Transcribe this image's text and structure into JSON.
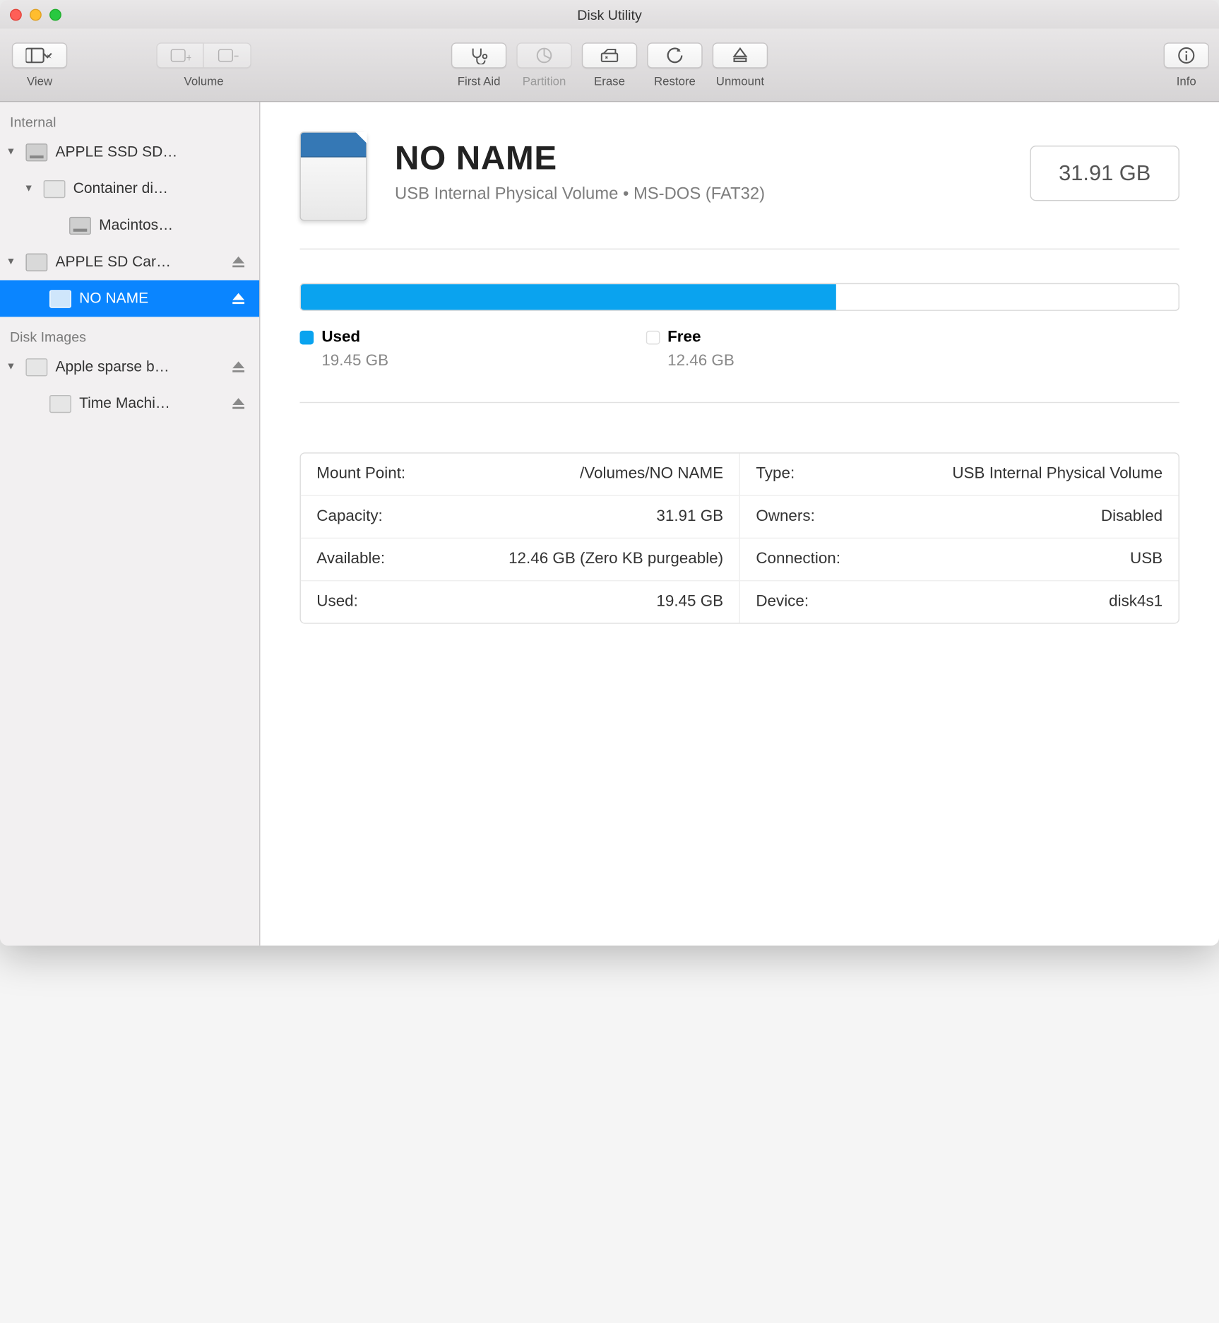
{
  "window": {
    "title": "Disk Utility"
  },
  "toolbar": {
    "view": "View",
    "volume": "Volume",
    "first_aid": "First Aid",
    "partition": "Partition",
    "erase": "Erase",
    "restore": "Restore",
    "unmount": "Unmount",
    "info": "Info"
  },
  "sidebar": {
    "group_internal": "Internal",
    "group_disk_images": "Disk Images",
    "items": [
      {
        "label": "APPLE SSD SD…"
      },
      {
        "label": "Container di…"
      },
      {
        "label": "Macintos…"
      },
      {
        "label": "APPLE SD Car…"
      },
      {
        "label": "NO NAME"
      },
      {
        "label": "Apple sparse b…"
      },
      {
        "label": "Time Machi…"
      }
    ]
  },
  "volume": {
    "name": "NO NAME",
    "subtitle": "USB Internal Physical Volume • MS-DOS (FAT32)",
    "size": "31.91 GB",
    "used_label": "Used",
    "used_value": "19.45 GB",
    "free_label": "Free",
    "free_value": "12.46 GB",
    "used_percent": 61
  },
  "details": {
    "left": [
      {
        "k": "Mount Point:",
        "v": "/Volumes/NO NAME"
      },
      {
        "k": "Capacity:",
        "v": "31.91 GB"
      },
      {
        "k": "Available:",
        "v": "12.46 GB (Zero KB purgeable)"
      },
      {
        "k": "Used:",
        "v": "19.45 GB"
      }
    ],
    "right": [
      {
        "k": "Type:",
        "v": "USB Internal Physical Volume"
      },
      {
        "k": "Owners:",
        "v": "Disabled"
      },
      {
        "k": "Connection:",
        "v": "USB"
      },
      {
        "k": "Device:",
        "v": "disk4s1"
      }
    ]
  }
}
